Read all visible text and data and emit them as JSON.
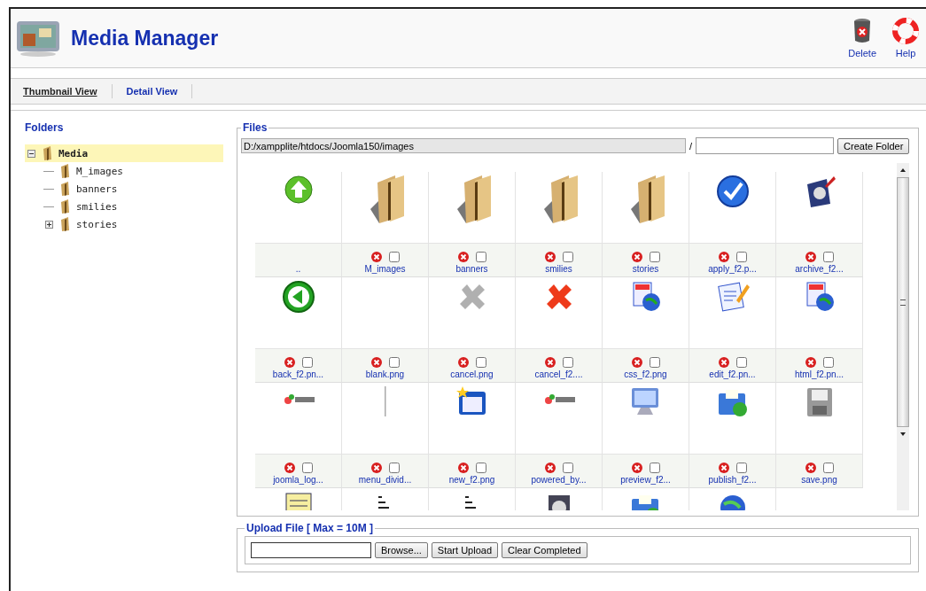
{
  "header": {
    "title": "Media Manager",
    "actions": [
      {
        "kind": "delete",
        "label": "Delete"
      },
      {
        "kind": "help",
        "label": "Help"
      }
    ]
  },
  "tabs": [
    {
      "label": "Thumbnail View",
      "selected": true
    },
    {
      "label": "Detail View",
      "selected": false
    }
  ],
  "folders": {
    "title": "Folders",
    "tree": [
      {
        "name": "Media",
        "selected": true,
        "expanded": true,
        "children": [
          {
            "name": "M_images",
            "selected": false
          },
          {
            "name": "banners",
            "selected": false
          },
          {
            "name": "smilies",
            "selected": false
          },
          {
            "name": "stories",
            "selected": false,
            "expanded": false
          }
        ]
      }
    ]
  },
  "files": {
    "title": "Files",
    "path": "D:/xampplite/htdocs/Joomla150/images",
    "separator": "/",
    "create_button": "Create Folder",
    "items": [
      {
        "kind": "parent",
        "name": ".."
      },
      {
        "kind": "folder",
        "name": "M_images",
        "checked": false
      },
      {
        "kind": "folder",
        "name": "banners",
        "checked": false
      },
      {
        "kind": "folder",
        "name": "smilies",
        "checked": false
      },
      {
        "kind": "folder",
        "name": "stories",
        "checked": false
      },
      {
        "kind": "file",
        "name": "apply_f2.p...",
        "checked": false
      },
      {
        "kind": "file",
        "name": "archive_f2...",
        "checked": false
      },
      {
        "kind": "file",
        "name": "back_f2.pn...",
        "checked": false
      },
      {
        "kind": "file",
        "name": "blank.png",
        "checked": false
      },
      {
        "kind": "file",
        "name": "cancel.png",
        "checked": false
      },
      {
        "kind": "file",
        "name": "cancel_f2....",
        "checked": false
      },
      {
        "kind": "file",
        "name": "css_f2.png",
        "checked": false
      },
      {
        "kind": "file",
        "name": "edit_f2.pn...",
        "checked": false
      },
      {
        "kind": "file",
        "name": "html_f2.pn...",
        "checked": false
      },
      {
        "kind": "file",
        "name": "joomla_log...",
        "checked": false
      },
      {
        "kind": "file",
        "name": "menu_divid...",
        "checked": false
      },
      {
        "kind": "file",
        "name": "new_f2.png",
        "checked": false
      },
      {
        "kind": "file",
        "name": "powered_by...",
        "checked": false
      },
      {
        "kind": "file",
        "name": "preview_f2...",
        "checked": false
      },
      {
        "kind": "file",
        "name": "publish_f2...",
        "checked": false
      },
      {
        "kind": "file",
        "name": "save.png",
        "checked": false
      },
      {
        "kind": "file"
      },
      {
        "kind": "file"
      },
      {
        "kind": "file"
      },
      {
        "kind": "file"
      },
      {
        "kind": "file"
      },
      {
        "kind": "file"
      }
    ]
  },
  "upload": {
    "title": "Upload File [ Max = 10M ]",
    "browse_button": "Browse...",
    "start_button": "Start Upload",
    "clear_button": "Clear Completed"
  }
}
